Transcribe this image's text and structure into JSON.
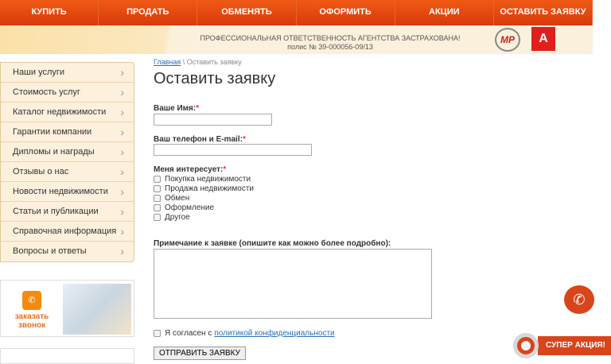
{
  "nav": [
    "КУПИТЬ",
    "ПРОДАТЬ",
    "ОБМЕНЯТЬ",
    "ОФОРМИТЬ",
    "АКЦИИ",
    "ОСТАВИТЬ ЗАЯВКУ"
  ],
  "banner": {
    "line1": "ПРОФЕССИОНАЛЬНАЯ ОТВЕТСТВЕННОСТЬ АГЕНТСТВА ЗАСТРАХОВАНА!",
    "line2": "полис № 39-000056-09/13"
  },
  "sidebar": [
    "Наши услуги",
    "Стоимость услуг",
    "Каталог недвижимости",
    "Гарантии компании",
    "Дипломы и награды",
    "Отзывы о нас",
    "Новости недвижимости",
    "Статьи и публикации",
    "Справочная информация",
    "Вопросы и ответы"
  ],
  "callback": {
    "label": "заказать звонок"
  },
  "breadcrumb": {
    "home": "Главная",
    "sep": " \\ ",
    "current": "Оставить заявку"
  },
  "title": "Оставить заявку",
  "form": {
    "name_label": "Ваше Имя:",
    "phone_label": "Ваш телефон и E-mail:",
    "interest_label": "Меня интересует:",
    "req": "*",
    "options": [
      "Покупка недвижимости",
      "Продажа недвижимости",
      "Обмен",
      "Оформление",
      "Другое"
    ],
    "note_label": "Примечание к заявке (опишите как можно более подробно):",
    "agree_text": "Я согласен с",
    "agree_link": "политикой конфиденциальности",
    "submit": "ОТПРАВИТЬ ЗАЯВКУ"
  },
  "promo": "СУПЕР АКЦИЯ!"
}
